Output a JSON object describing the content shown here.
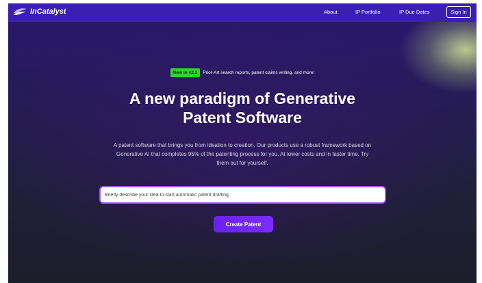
{
  "nav": {
    "brand": "InCatalyst",
    "links": [
      "About",
      "IP Portfolio",
      "IP Due Dates"
    ],
    "signin_label": "Sign In"
  },
  "hero": {
    "badge": "New in v2.2",
    "announcement": "Prior-Art search reports, patent claims writing, and more!",
    "headline_line1": "A new paradigm of Generative",
    "headline_line2": "Patent Software",
    "description": "A patent software that brings you from ideation to creation. Our products use a robust framework based on Generative AI that completes 95% of the patenting process for you. At lower costs and in faster time. Try them out for yourself."
  },
  "form": {
    "idea_placeholder": "Briefly describe your idea to start automatic patent drafting",
    "idea_value": "",
    "submit_label": "Create Patent"
  },
  "colors": {
    "nav_bg": "#3a1fb0",
    "badge_bg": "#2fd52f",
    "button_bg": "#6b21f0",
    "input_border": "#9c57ff"
  }
}
